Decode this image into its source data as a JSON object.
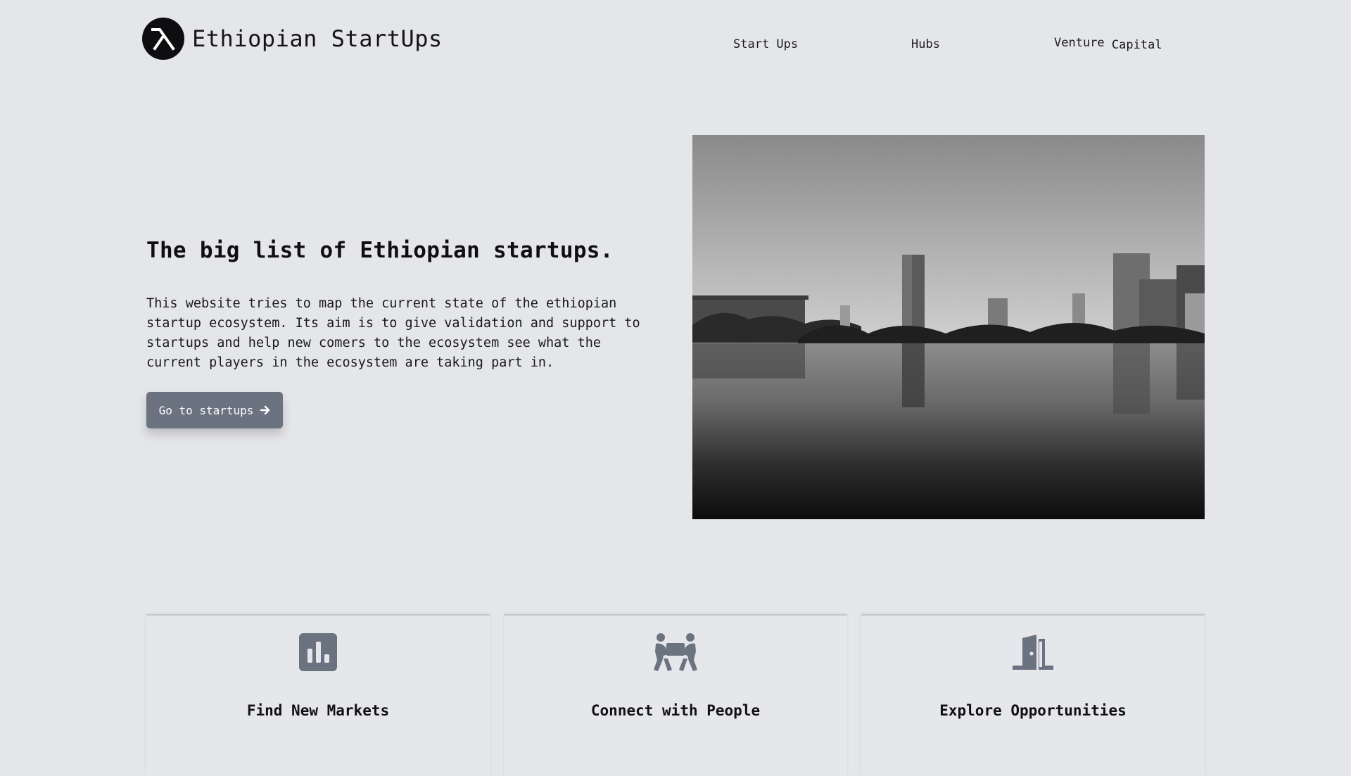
{
  "header": {
    "brand": "Ethiopian StartUps",
    "nav": [
      {
        "label": "Start Ups"
      },
      {
        "label": "Hubs"
      },
      {
        "label_part1": "Venture",
        "label_part2": "Capital"
      }
    ]
  },
  "hero": {
    "title": "The big list of Ethiopian startups.",
    "description": "This website tries to map the current state of the ethiopian startup ecosystem. Its aim is to give validation and support to startups and help new comers to the ecosystem see what the current players in the ecosystem are taking part in.",
    "cta_label": "Go to startups",
    "image_icon": "city-lake-reflection-photo"
  },
  "features": [
    {
      "title": "Find New Markets",
      "icon": "bar-chart-icon"
    },
    {
      "title": "Connect with People",
      "icon": "people-carry-icon"
    },
    {
      "title": "Explore Opportunities",
      "icon": "door-open-icon"
    }
  ],
  "colors": {
    "background": "#e5e6ea",
    "button": "#6b7280",
    "icon": "#6b7280",
    "logo": "#0e0e10"
  }
}
